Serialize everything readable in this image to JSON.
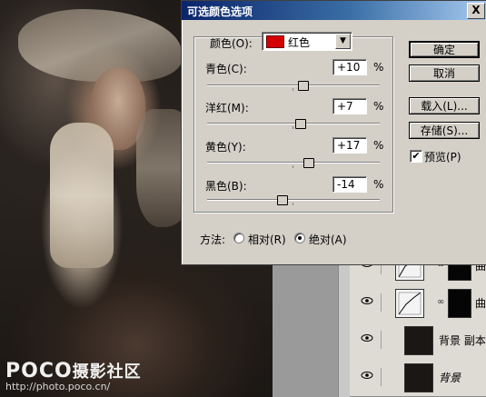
{
  "watermark": {
    "brand": "POCO",
    "brand_suffix": "摄影社区",
    "url": "http://photo.poco.cn/"
  },
  "dialog": {
    "title": "可选颜色选项",
    "close_label": "X",
    "color_label": "颜色(O):",
    "color_value": "红色",
    "color_swatch": "#d40000",
    "adjustments": [
      {
        "label": "青色(C):",
        "value": "+10",
        "unit": "%",
        "percent": 10
      },
      {
        "label": "洋红(M):",
        "value": "+7",
        "unit": "%",
        "percent": 7
      },
      {
        "label": "黄色(Y):",
        "value": "+17",
        "unit": "%",
        "percent": 17
      },
      {
        "label": "黑色(B):",
        "value": "-14",
        "unit": "%",
        "percent": -14
      }
    ],
    "buttons": {
      "ok": "确定",
      "cancel": "取消",
      "load": "载入(L)...",
      "save": "存储(S)..."
    },
    "preview_label": "预览(P)",
    "preview_checked": true,
    "method_label": "方法:",
    "method_options": [
      {
        "label": "相对(R)",
        "checked": false
      },
      {
        "label": "绝对(A)",
        "checked": true
      }
    ]
  },
  "layers": [
    {
      "name": "",
      "tail": "曲",
      "kind": "curve"
    },
    {
      "name": "",
      "tail": "曲",
      "kind": "curve"
    },
    {
      "name": "背景 副本",
      "tail": "",
      "kind": "photo"
    },
    {
      "name": "背景",
      "tail": "",
      "kind": "photo",
      "italic": true
    }
  ]
}
